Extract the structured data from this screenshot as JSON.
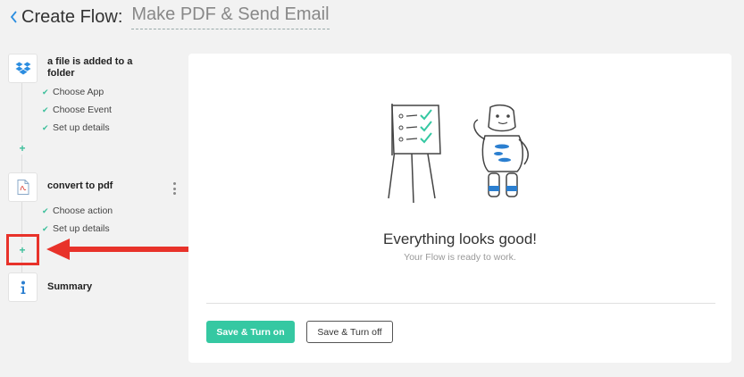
{
  "header": {
    "title": "Create Flow:",
    "flow_name": "Make PDF & Send Email"
  },
  "sidebar": {
    "steps": [
      {
        "icon": "dropbox-icon",
        "title": "a file is added to a folder",
        "substeps": [
          "Choose App",
          "Choose Event",
          "Set up details"
        ]
      },
      {
        "icon": "pdf-file-icon",
        "title": "convert to pdf",
        "substeps": [
          "Choose action",
          "Set up details"
        ]
      },
      {
        "icon": "info-icon",
        "title": "Summary",
        "substeps": []
      }
    ]
  },
  "main": {
    "title": "Everything looks good!",
    "subtitle": "Your Flow is ready to work.",
    "primary_button": "Save & Turn on",
    "secondary_button": "Save & Turn off"
  },
  "colors": {
    "accent": "#35c8a2",
    "highlight": "#e8322a",
    "dropbox": "#2b8de0",
    "info": "#2b7fd0"
  }
}
